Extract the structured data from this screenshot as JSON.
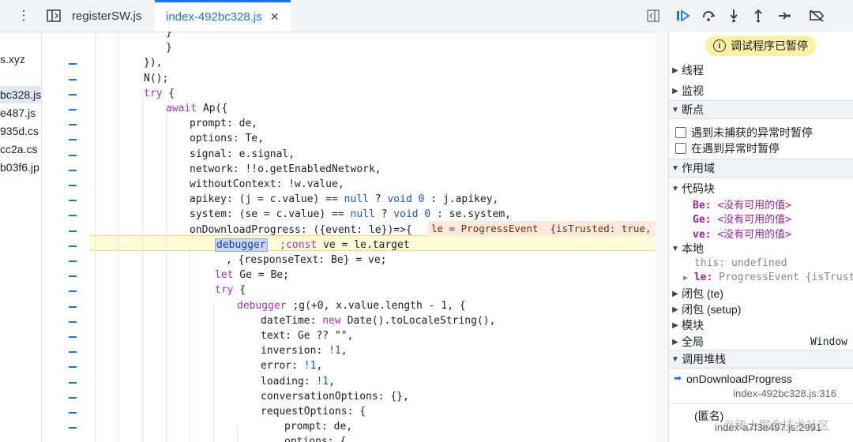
{
  "toolbar": {
    "tabs": [
      {
        "label": "registerSW.js"
      },
      {
        "label": "index-492bc328.js",
        "close": "✕"
      }
    ]
  },
  "files": [
    "s.xyz",
    "bc328.js",
    "e487.js",
    "935d.cs",
    "cc2a.cs",
    "b03f6.jp"
  ],
  "code": {
    "lines": [
      "}",
      "}",
      "}),",
      "N();",
      "try {",
      "await Ap({",
      "prompt: de,",
      "options: Te,",
      "signal: e.signal,",
      "network: !!o.getEnabledNetwork,",
      "withoutContext: !w.value,",
      "apikey: (j = c.value) == null ? void 0 : j.apikey,",
      "system: (se = c.value) == null ? void 0 : se.system,",
      "onDownloadProgress: ({event: le})=>{",
      "debugger ;const ve = le.target",
      ", {responseText: Be} = ve;",
      "let Ge = Be;",
      "try {",
      "debugger ;g(+0, x.value.length - 1, {",
      "dateTime: new Date().toLocaleString(),",
      "text: Ge ?? \"\",",
      "inversion: !1,",
      "error: !1,",
      "loading: !1,",
      "conversationOptions: {},",
      "requestOptions: {",
      "prompt: de,",
      "options: {"
    ],
    "inline_value": "le = ProgressEvent  {isTrusted: true, l"
  },
  "debugger": {
    "paused_label": "调试程序已暂停",
    "sections": {
      "threads": "线程",
      "watch": "监视",
      "breakpoints": "断点",
      "scope": "作用域",
      "callstack": "调用堆栈"
    },
    "breakpoint_options": [
      "遇到未捕获的异常时暂停",
      "在遇到异常时暂停"
    ],
    "scope": {
      "block_label": "代码块",
      "block_vars": [
        {
          "name": "Be",
          "value": "<没有可用的值>"
        },
        {
          "name": "Ge",
          "value": "<没有可用的值>"
        },
        {
          "name": "ve",
          "value": "<没有可用的值>"
        }
      ],
      "local_label": "本地",
      "this_name": "this",
      "this_value": "undefined",
      "le_name": "le",
      "le_value": "ProgressEvent  {isTrust",
      "closure1": "闭包 (te)",
      "closure2": "闭包 (setup)",
      "module": "模块",
      "global": "全局",
      "global_value": "Window"
    },
    "callstack": [
      {
        "fn": "onDownloadProgress",
        "loc": "index-492bc328.js:316"
      },
      {
        "fn": "(匿名)",
        "loc": "index-a7f3e497.js:2991"
      }
    ]
  },
  "watermark": "@稀土掘金技术社区"
}
